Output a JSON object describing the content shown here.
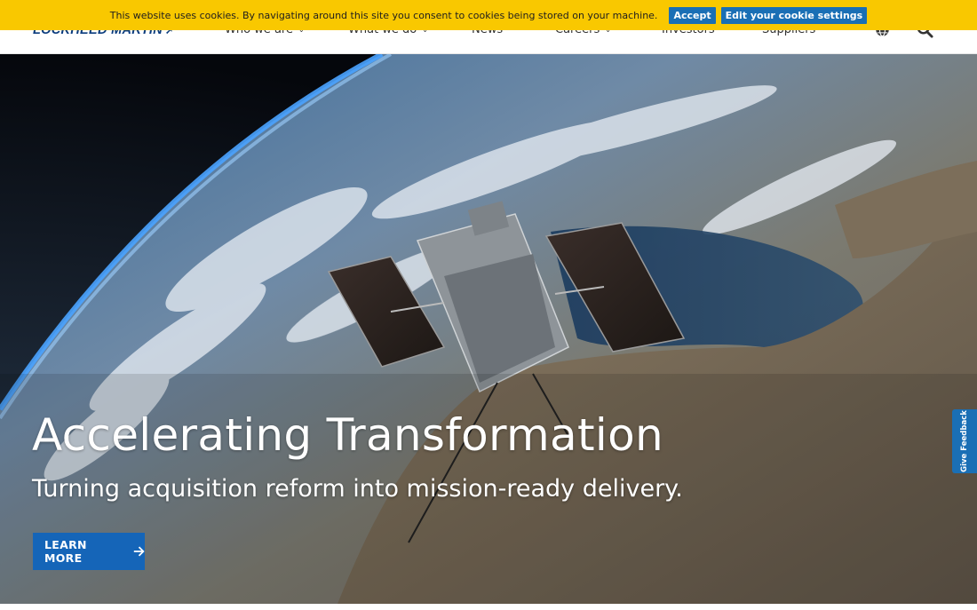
{
  "cookie_banner": {
    "message": "This website uses cookies. By navigating around this site you consent to cookies being stored on your machine.",
    "accept_label": "Accept",
    "settings_label": "Edit your cookie settings",
    "color": "#f9c800"
  },
  "header": {
    "logo_text": "LOCKHEED MARTIN",
    "nav": [
      {
        "label": "Who we are",
        "has_dropdown": true
      },
      {
        "label": "What we do",
        "has_dropdown": true
      },
      {
        "label": "News",
        "has_dropdown": false
      },
      {
        "label": "Careers",
        "has_dropdown": true
      },
      {
        "label": "Investors",
        "has_dropdown": false
      },
      {
        "label": "Suppliers",
        "has_dropdown": false
      }
    ],
    "icons": [
      "globe-icon",
      "search-icon"
    ]
  },
  "hero": {
    "title": "Accelerating Transformation",
    "subtitle": "Turning acquisition reform into mission-ready delivery.",
    "cta_label": "LEARN MORE",
    "cta_color": "#1565b8"
  },
  "feedback": {
    "label": "Give Feedback",
    "color": "#1a6fb5"
  }
}
